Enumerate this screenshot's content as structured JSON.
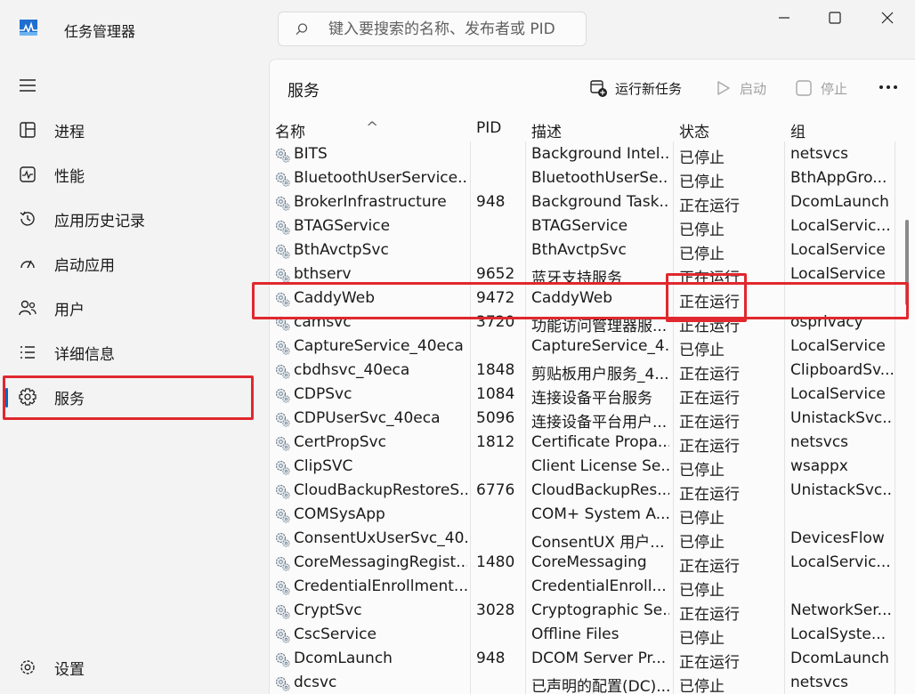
{
  "window": {
    "title": "任务管理器",
    "accent": "#0067c0",
    "highlight": "#e0282e"
  },
  "search": {
    "placeholder": "键入要搜索的名称、发布者或 PID"
  },
  "sidebar": {
    "items": [
      {
        "label": "进程",
        "icon": "processes-icon"
      },
      {
        "label": "性能",
        "icon": "performance-icon"
      },
      {
        "label": "应用历史记录",
        "icon": "app-history-icon"
      },
      {
        "label": "启动应用",
        "icon": "startup-apps-icon"
      },
      {
        "label": "用户",
        "icon": "users-icon"
      },
      {
        "label": "详细信息",
        "icon": "details-icon"
      },
      {
        "label": "服务",
        "icon": "services-icon"
      }
    ],
    "settings_label": "设置",
    "active": "服务"
  },
  "toolbar": {
    "page_title": "服务",
    "run_new_task": "运行新任务",
    "start": "启动",
    "stop": "停止"
  },
  "table": {
    "columns": [
      "名称",
      "PID",
      "描述",
      "状态",
      "组"
    ],
    "rows": [
      {
        "name": "BITS",
        "pid": "",
        "desc": "Background Intel...",
        "status": "已停止",
        "group": "netsvcs"
      },
      {
        "name": "BluetoothUserService...",
        "pid": "",
        "desc": "BluetoothUserSe...",
        "status": "已停止",
        "group": "BthAppGro..."
      },
      {
        "name": "BrokerInfrastructure",
        "pid": "948",
        "desc": "Background Task...",
        "status": "正在运行",
        "group": "DcomLaunch"
      },
      {
        "name": "BTAGService",
        "pid": "",
        "desc": "BTAGService",
        "status": "已停止",
        "group": "LocalServic..."
      },
      {
        "name": "BthAvctpSvc",
        "pid": "",
        "desc": "BthAvctpSvc",
        "status": "已停止",
        "group": "LocalService"
      },
      {
        "name": "bthserv",
        "pid": "9652",
        "desc": "蓝牙支持服务",
        "status": "正在运行",
        "group": "LocalService"
      },
      {
        "name": "CaddyWeb",
        "pid": "9472",
        "desc": "CaddyWeb",
        "status": "正在运行",
        "group": ""
      },
      {
        "name": "camsvc",
        "pid": "3720",
        "desc": "功能访问管理器服...",
        "status": "正在运行",
        "group": "osprivacy"
      },
      {
        "name": "CaptureService_40eca",
        "pid": "",
        "desc": "CaptureService_4...",
        "status": "已停止",
        "group": "LocalService"
      },
      {
        "name": "cbdhsvc_40eca",
        "pid": "1848",
        "desc": "剪贴板用户服务_4...",
        "status": "正在运行",
        "group": "ClipboardSv..."
      },
      {
        "name": "CDPSvc",
        "pid": "1084",
        "desc": "连接设备平台服务",
        "status": "正在运行",
        "group": "LocalService"
      },
      {
        "name": "CDPUserSvc_40eca",
        "pid": "5096",
        "desc": "连接设备平台用户...",
        "status": "正在运行",
        "group": "UnistackSvc..."
      },
      {
        "name": "CertPropSvc",
        "pid": "1812",
        "desc": "Certificate Propa...",
        "status": "正在运行",
        "group": "netsvcs"
      },
      {
        "name": "ClipSVC",
        "pid": "",
        "desc": "Client License Se...",
        "status": "已停止",
        "group": "wsappx"
      },
      {
        "name": "CloudBackupRestoreS...",
        "pid": "6776",
        "desc": "CloudBackupRes...",
        "status": "正在运行",
        "group": "UnistackSvc..."
      },
      {
        "name": "COMSysApp",
        "pid": "",
        "desc": "COM+ System A...",
        "status": "已停止",
        "group": ""
      },
      {
        "name": "ConsentUxUserSvc_40...",
        "pid": "",
        "desc": "ConsentUX 用户...",
        "status": "已停止",
        "group": "DevicesFlow"
      },
      {
        "name": "CoreMessagingRegist...",
        "pid": "1480",
        "desc": "CoreMessaging",
        "status": "正在运行",
        "group": "LocalServic..."
      },
      {
        "name": "CredentialEnrollment...",
        "pid": "",
        "desc": "CredentialEnroll...",
        "status": "已停止",
        "group": ""
      },
      {
        "name": "CryptSvc",
        "pid": "3028",
        "desc": "Cryptographic Se...",
        "status": "正在运行",
        "group": "NetworkSer..."
      },
      {
        "name": "CscService",
        "pid": "",
        "desc": "Offline Files",
        "status": "已停止",
        "group": "LocalSyste..."
      },
      {
        "name": "DcomLaunch",
        "pid": "948",
        "desc": "DCOM Server Pr...",
        "status": "正在运行",
        "group": "DcomLaunch"
      },
      {
        "name": "dcsvc",
        "pid": "",
        "desc": "已声明的配置(DC)...",
        "status": "已停止",
        "group": "netsvcs"
      }
    ]
  }
}
